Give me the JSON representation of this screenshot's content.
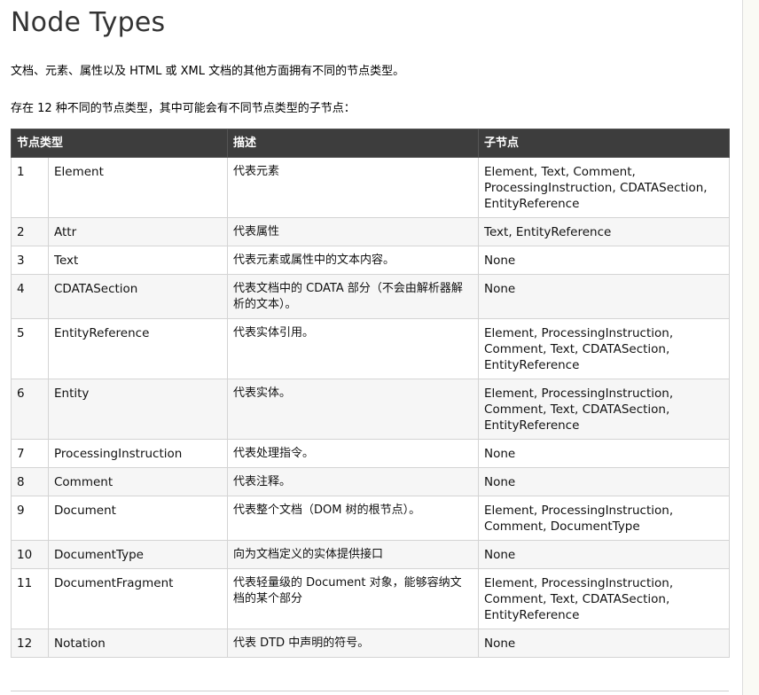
{
  "title": "Node Types",
  "intro1": "文档、元素、属性以及 HTML 或 XML 文档的其他方面拥有不同的节点类型。",
  "intro2": "存在 12 种不同的节点类型，其中可能会有不同节点类型的子节点：",
  "table": {
    "headers": [
      "节点类型",
      "描述",
      "子节点"
    ],
    "rows": [
      [
        "1",
        "Element",
        "代表元素",
        "Element, Text, Comment, ProcessingInstruction, CDATASection, EntityReference"
      ],
      [
        "2",
        "Attr",
        "代表属性",
        "Text, EntityReference"
      ],
      [
        "3",
        "Text",
        "代表元素或属性中的文本内容。",
        "None"
      ],
      [
        "4",
        "CDATASection",
        "代表文档中的 CDATA 部分（不会由解析器解析的文本）。",
        "None"
      ],
      [
        "5",
        "EntityReference",
        "代表实体引用。",
        "Element, ProcessingInstruction, Comment, Text, CDATASection, EntityReference"
      ],
      [
        "6",
        "Entity",
        "代表实体。",
        "Element, ProcessingInstruction, Comment, Text, CDATASection, EntityReference"
      ],
      [
        "7",
        "ProcessingInstruction",
        "代表处理指令。",
        "None"
      ],
      [
        "8",
        "Comment",
        "代表注释。",
        "None"
      ],
      [
        "9",
        "Document",
        "代表整个文档（DOM 树的根节点）。",
        "Element, ProcessingInstruction, Comment, DocumentType"
      ],
      [
        "10",
        "DocumentType",
        "向为文档定义的实体提供接口",
        "None"
      ],
      [
        "11",
        "DocumentFragment",
        "代表轻量级的 Document 对象，能够容纳文档的某个部分",
        "Element, ProcessingInstruction, Comment, Text, CDATASection, EntityReference"
      ],
      [
        "12",
        "Notation",
        "代表 DTD 中声明的符号。",
        "None"
      ]
    ]
  }
}
